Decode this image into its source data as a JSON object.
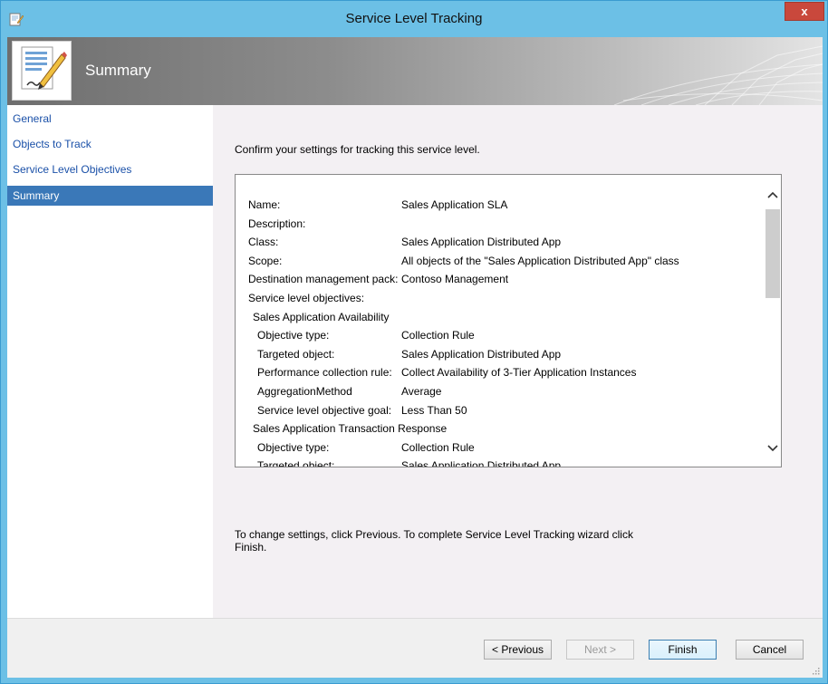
{
  "window": {
    "title": "Service Level Tracking",
    "close_label": "x"
  },
  "header": {
    "title": "Summary"
  },
  "sidebar": {
    "items": [
      {
        "label": "General"
      },
      {
        "label": "Objects to Track"
      },
      {
        "label": "Service Level Objectives"
      },
      {
        "label": "Summary",
        "selected": true
      }
    ]
  },
  "main": {
    "confirm_text": "Confirm your settings for tracking this service level.",
    "summary_rows": [
      {
        "label": "Name:",
        "value": "Sales Application SLA",
        "indent": 0
      },
      {
        "label": "Description:",
        "value": "",
        "indent": 0
      },
      {
        "label": "Class:",
        "value": "Sales Application Distributed App",
        "indent": 0
      },
      {
        "label": "Scope:",
        "value": "All objects of the \"Sales Application Distributed App\" class",
        "indent": 0
      },
      {
        "label": "Destination management pack:",
        "value": "Contoso Management",
        "indent": 0
      },
      {
        "label": "Service level objectives:",
        "value": "",
        "indent": 0
      },
      {
        "label": "Sales Application Availability",
        "value": "",
        "indent": 1
      },
      {
        "label": "Objective type:",
        "value": "Collection Rule",
        "indent": 2
      },
      {
        "label": "Targeted object:",
        "value": "Sales Application Distributed App",
        "indent": 2
      },
      {
        "label": "Performance collection rule:",
        "value": "Collect Availability of 3-Tier Application Instances",
        "indent": 2
      },
      {
        "label": "AggregationMethod",
        "value": "Average",
        "indent": 2
      },
      {
        "label": "Service level objective goal:",
        "value": "Less Than 50",
        "indent": 2
      },
      {
        "label": "Sales Application Transaction Response",
        "value": "",
        "indent": 1
      },
      {
        "label": "Objective type:",
        "value": "Collection Rule",
        "indent": 2
      },
      {
        "label": "Targeted object:",
        "value": "Sales Application Distributed App",
        "indent": 2
      }
    ],
    "footer_text": "To change settings, click Previous. To complete Service Level Tracking wizard click Finish."
  },
  "buttons": {
    "previous": "< Previous",
    "next": "Next >",
    "finish": "Finish",
    "cancel": "Cancel"
  },
  "colors": {
    "title_bar": "#6cc0e6",
    "selected_nav": "#3a78b8",
    "nav_link": "#1a50a8"
  }
}
